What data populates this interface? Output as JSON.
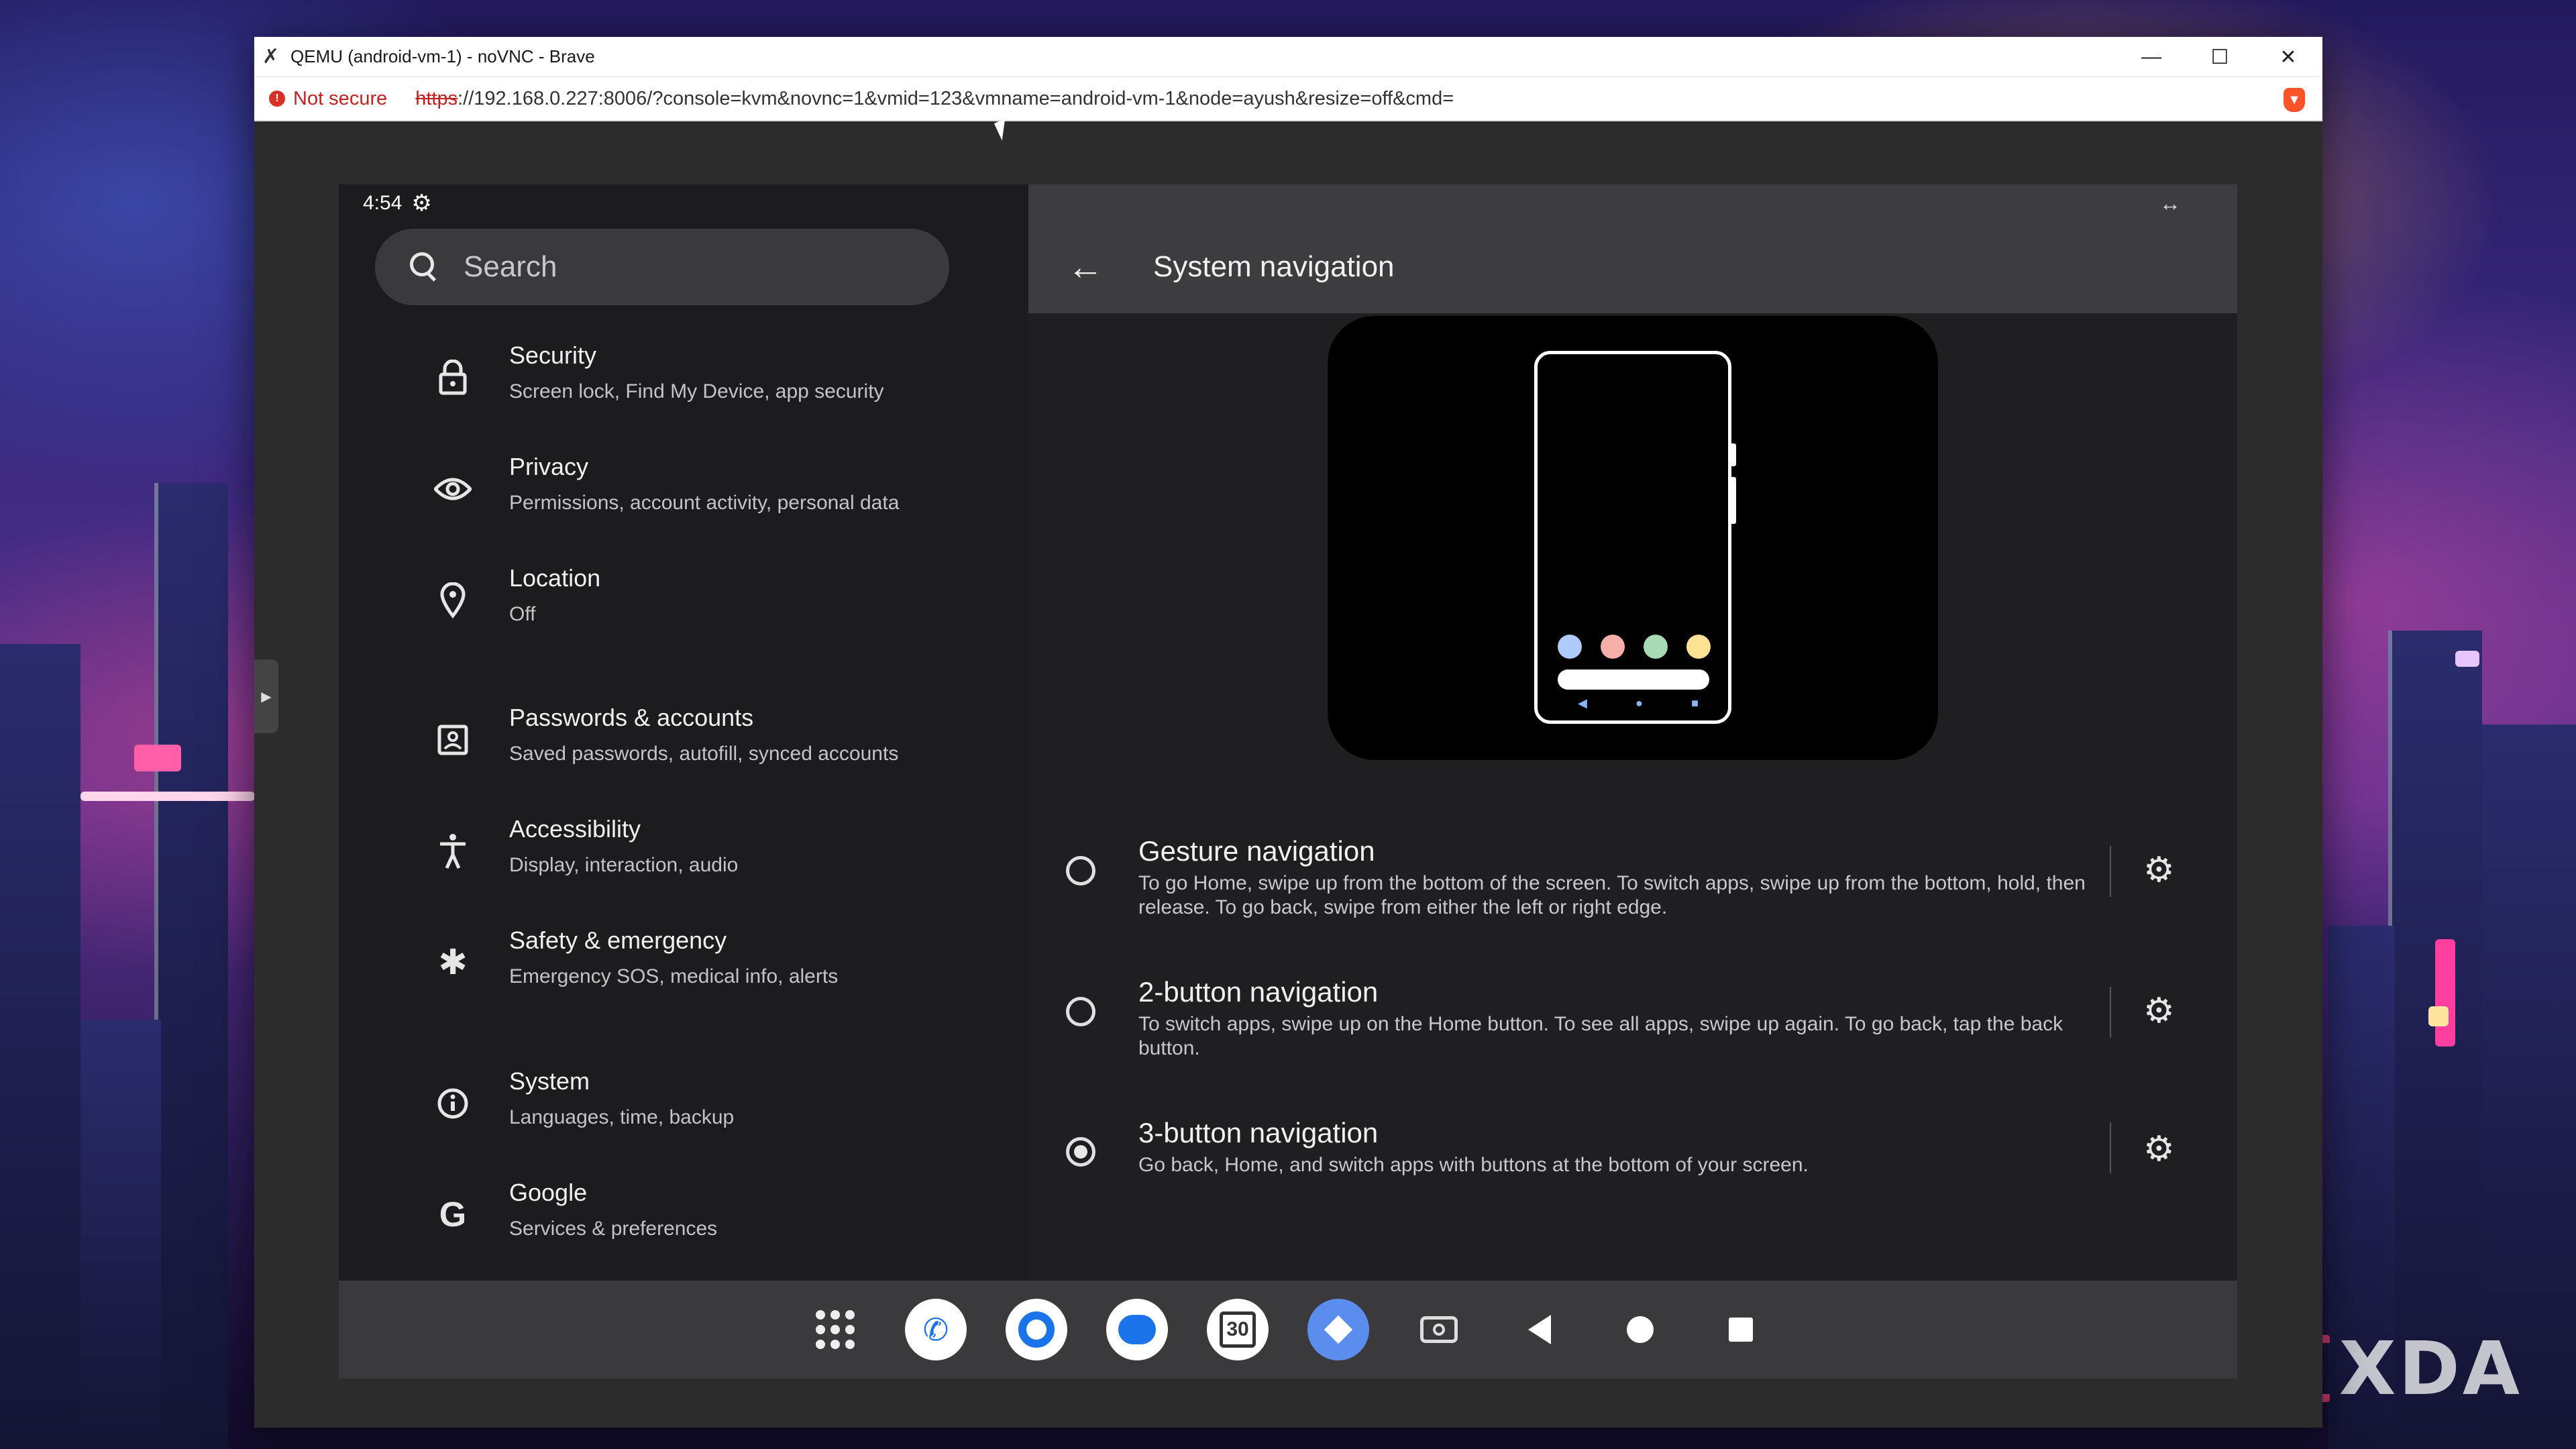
{
  "window": {
    "title": "QEMU (android-vm-1) - noVNC - Brave",
    "minimize": "—",
    "maximize": "☐",
    "close": "✕"
  },
  "address": {
    "not_secure": "Not secure",
    "scheme": "https",
    "url_rest": "://192.168.0.227:8006/?console=kvm&novnc=1&vmid=123&vmname=android-vm-1&node=ayush&resize=off&cmd="
  },
  "status": {
    "time": "4:54"
  },
  "search": {
    "placeholder": "Search"
  },
  "settings_menu": [
    {
      "title": "Security",
      "subtitle": "Screen lock, Find My Device, app security",
      "icon": "lock-icon"
    },
    {
      "title": "Privacy",
      "subtitle": "Permissions, account activity, personal data",
      "icon": "eye-icon"
    },
    {
      "title": "Location",
      "subtitle": "Off",
      "icon": "location-pin-icon"
    },
    {
      "title": "Passwords & accounts",
      "subtitle": "Saved passwords, autofill, synced accounts",
      "icon": "account-box-icon"
    },
    {
      "title": "Accessibility",
      "subtitle": "Display, interaction, audio",
      "icon": "accessibility-icon"
    },
    {
      "title": "Safety & emergency",
      "subtitle": "Emergency SOS, medical info, alerts",
      "icon": "asterisk-icon"
    },
    {
      "title": "System",
      "subtitle": "Languages, time, backup",
      "icon": "info-icon"
    },
    {
      "title": "Google",
      "subtitle": "Services & preferences",
      "icon": "google-icon"
    }
  ],
  "detail": {
    "title": "System navigation",
    "options": [
      {
        "title": "Gesture navigation",
        "description": "To go Home, swipe up from the bottom of the screen. To switch apps, swipe up from the bottom, hold, then release. To go back, swipe from either the left or right edge.",
        "selected": false
      },
      {
        "title": "2-button navigation",
        "description": "To switch apps, swipe up on the Home button. To see all apps, swipe up again. To go back, tap the back button.",
        "selected": false
      },
      {
        "title": "3-button navigation",
        "description": "Go back, Home, and switch apps with buttons at the bottom of your screen.",
        "selected": true
      }
    ]
  },
  "taskbar": {
    "apps": [
      "app-drawer-icon",
      "phone-app-icon",
      "chrome-app-icon",
      "messages-app-icon",
      "calendar-app-icon",
      "maps-app-icon",
      "camera-app-icon"
    ],
    "calendar_day": "30"
  },
  "watermark": {
    "text": "XDA"
  },
  "colors": {
    "dot1": "#aecbfa",
    "dot2": "#f6aea9",
    "dot3": "#a8dab5",
    "dot4": "#fde293",
    "warn": "#c5221f",
    "brave": "#fb542b"
  }
}
